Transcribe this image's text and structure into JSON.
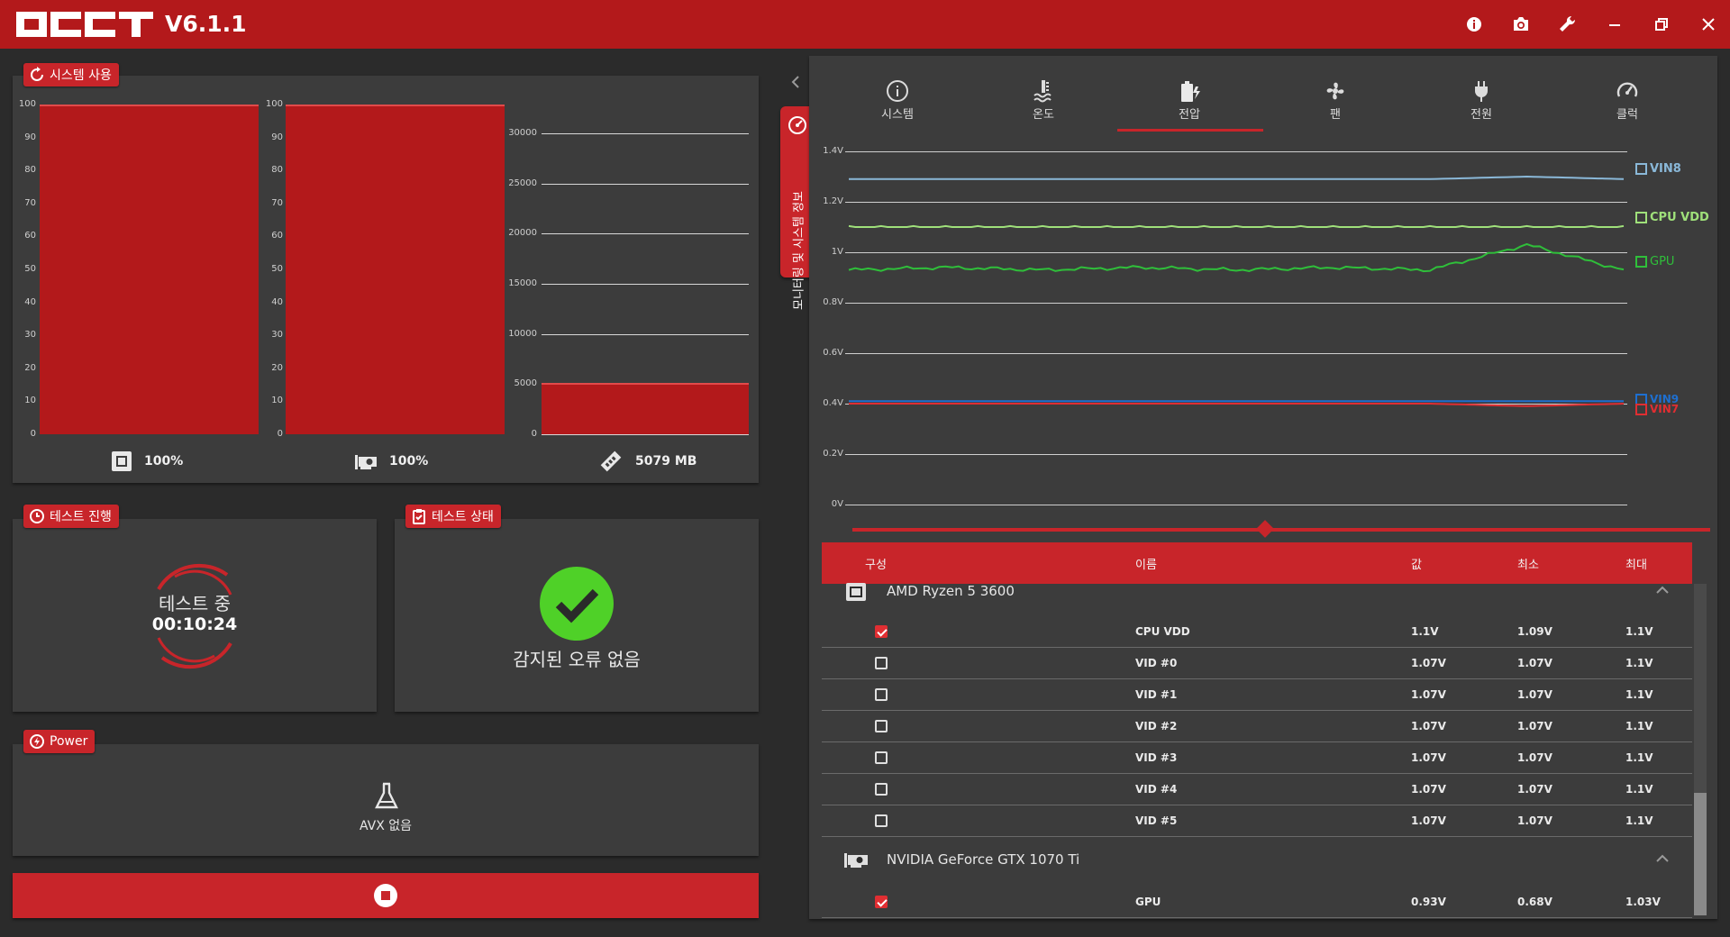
{
  "app": {
    "logo_text": "OCCT",
    "version": "V6.1.1",
    "controls": [
      "info-icon",
      "camera-icon",
      "wrench-icon",
      "minimize-icon",
      "restore-icon",
      "close-icon"
    ]
  },
  "system_usage": {
    "label": "시스템 사용",
    "cpu_axis": [
      "100",
      "90",
      "80",
      "70",
      "60",
      "50",
      "40",
      "30",
      "20",
      "10",
      "0"
    ],
    "gpu_axis": [
      "100",
      "90",
      "80",
      "70",
      "60",
      "50",
      "40",
      "30",
      "20",
      "10",
      "0"
    ],
    "mem_axis": [
      "30000",
      "25000",
      "20000",
      "15000",
      "10000",
      "5000",
      "0"
    ],
    "cpu_percent": 100,
    "gpu_percent": 100,
    "mem_mb": 5079,
    "cpu_value": "100%",
    "gpu_value": "100%",
    "mem_value": "5079 MB"
  },
  "test_progress": {
    "label": "테스트 진행",
    "status": "테스트 중",
    "elapsed": "00:10:24"
  },
  "test_status": {
    "label": "테스트 상태",
    "message": "감지된 오류 없음"
  },
  "power": {
    "label": "Power",
    "avx": "AVX 없음"
  },
  "side_tab": {
    "label": "모니터링 및 시스템 정보"
  },
  "monitor_tabs": [
    {
      "label": "시스템",
      "icon": "info-icon"
    },
    {
      "label": "온도",
      "icon": "thermometer-icon"
    },
    {
      "label": "전압",
      "icon": "battery-bolt-icon",
      "active": true
    },
    {
      "label": "팬",
      "icon": "fan-icon"
    },
    {
      "label": "전원",
      "icon": "plug-icon"
    },
    {
      "label": "클럭",
      "icon": "gauge-icon"
    }
  ],
  "voltage_chart": {
    "y_ticks": [
      "1.4V",
      "1.2V",
      "1V",
      "0.8V",
      "0.6V",
      "0.4V",
      "0.2V",
      "0V"
    ],
    "legend": [
      {
        "name": "VIN8",
        "color": "#8ab8d8"
      },
      {
        "name": "CPU VDD",
        "color": "#9fe07a"
      },
      {
        "name": "GPU",
        "color": "#2fbf3a"
      },
      {
        "name": "VIN9",
        "color": "#1e6fd0"
      },
      {
        "name": "VIN7",
        "color": "#e02e32"
      }
    ]
  },
  "chart_data": {
    "type": "line",
    "ylim": [
      0,
      1.4
    ],
    "series": [
      {
        "name": "VIN8",
        "values": [
          1.29,
          1.29,
          1.29,
          1.29,
          1.29,
          1.29,
          1.29,
          1.3,
          1.29
        ]
      },
      {
        "name": "CPU VDD",
        "values": [
          1.1,
          1.1,
          1.1,
          1.1,
          1.1,
          1.1,
          1.1,
          1.1,
          1.1
        ]
      },
      {
        "name": "GPU",
        "values": [
          0.93,
          0.94,
          0.93,
          0.94,
          0.93,
          0.94,
          0.93,
          1.03,
          0.93
        ]
      },
      {
        "name": "VIN9",
        "values": [
          0.41,
          0.41,
          0.41,
          0.41,
          0.41,
          0.41,
          0.41,
          0.41,
          0.41
        ]
      },
      {
        "name": "VIN7",
        "values": [
          0.4,
          0.4,
          0.4,
          0.4,
          0.4,
          0.4,
          0.4,
          0.39,
          0.4
        ]
      }
    ]
  },
  "table": {
    "headers": {
      "component": "구성",
      "name": "이름",
      "value": "값",
      "min": "최소",
      "max": "최대"
    },
    "groups": [
      {
        "name": "AMD Ryzen 5 3600",
        "rows": [
          {
            "name": "CPU VDD",
            "value": "1.1V",
            "min": "1.09V",
            "max": "1.1V",
            "checked": true
          },
          {
            "name": "VID #0",
            "value": "1.07V",
            "min": "1.07V",
            "max": "1.1V",
            "checked": false
          },
          {
            "name": "VID #1",
            "value": "1.07V",
            "min": "1.07V",
            "max": "1.1V",
            "checked": false
          },
          {
            "name": "VID #2",
            "value": "1.07V",
            "min": "1.07V",
            "max": "1.1V",
            "checked": false
          },
          {
            "name": "VID #3",
            "value": "1.07V",
            "min": "1.07V",
            "max": "1.1V",
            "checked": false
          },
          {
            "name": "VID #4",
            "value": "1.07V",
            "min": "1.07V",
            "max": "1.1V",
            "checked": false
          },
          {
            "name": "VID #5",
            "value": "1.07V",
            "min": "1.07V",
            "max": "1.1V",
            "checked": false
          }
        ]
      },
      {
        "name": "NVIDIA GeForce GTX 1070 Ti",
        "rows": [
          {
            "name": "GPU",
            "value": "0.93V",
            "min": "0.68V",
            "max": "1.03V",
            "checked": true
          }
        ]
      }
    ]
  }
}
